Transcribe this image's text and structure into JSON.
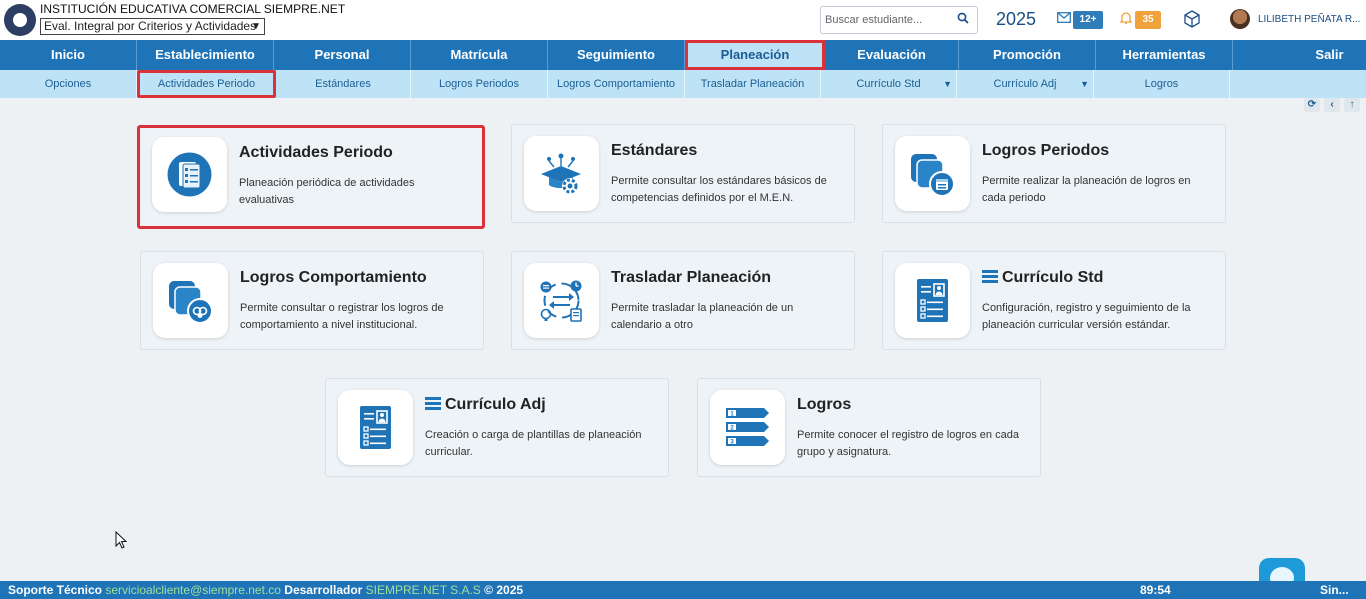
{
  "header": {
    "institution": "INSTITUCIÓN EDUCATIVA COMERCIAL SIEMPRE.NET",
    "mode_selected": "Eval. Integral por Criterios y Actividades",
    "search_placeholder": "Buscar estudiante...",
    "year": "2025",
    "messages_badge": "12+",
    "notifications_badge": "35",
    "user_name": "LILIBETH PEÑATA R..."
  },
  "nav": {
    "items": [
      "Inicio",
      "Establecimiento",
      "Personal",
      "Matrícula",
      "Seguimiento",
      "Planeación",
      "Evaluación",
      "Promoción",
      "Herramientas",
      "Salir"
    ]
  },
  "subnav": {
    "items": [
      "Opciones",
      "Actividades Periodo",
      "Estándares",
      "Logros Periodos",
      "Logros Comportamiento",
      "Trasladar Planeación",
      "Currículo Std",
      "Currículo Adj",
      "Logros"
    ]
  },
  "cards": [
    {
      "title": "Actividades Periodo",
      "desc": "Planeación periódica de actividades evaluativas"
    },
    {
      "title": "Estándares",
      "desc": "Permite consultar los estándares básicos de competencias definidos por el M.E.N."
    },
    {
      "title": "Logros Periodos",
      "desc": "Permite realizar la planeación de logros en cada periodo"
    },
    {
      "title": "Logros Comportamiento",
      "desc": "Permite consultar o registrar los logros de comportamiento a nivel institucional."
    },
    {
      "title": "Trasladar Planeación",
      "desc": "Permite trasladar la planeación de un calendario a otro"
    },
    {
      "title": "Currículo Std",
      "desc": "Configuración, registro y seguimiento de la planeación curricular versión estándar."
    },
    {
      "title": "Currículo Adj",
      "desc": "Creación o carga de plantillas de planeación curricular."
    },
    {
      "title": "Logros",
      "desc": "Permite conocer el registro de logros en cada grupo y asignatura."
    }
  ],
  "footer": {
    "support_label": "Soporte Técnico",
    "support_email": "servicioalcliente@siempre.net.co",
    "developer_label": "Desarrollador",
    "developer_name": "SIEMPRE.NET S.A.S",
    "copyright": "© 2025",
    "timer": "89:54",
    "brand": "Sin..."
  },
  "colors": {
    "primary": "#1f73b7",
    "subnav": "#bfe3f6",
    "highlight": "#d9323a",
    "badge_messages": "#2e7cb8",
    "badge_notifications": "#f0a23c"
  }
}
